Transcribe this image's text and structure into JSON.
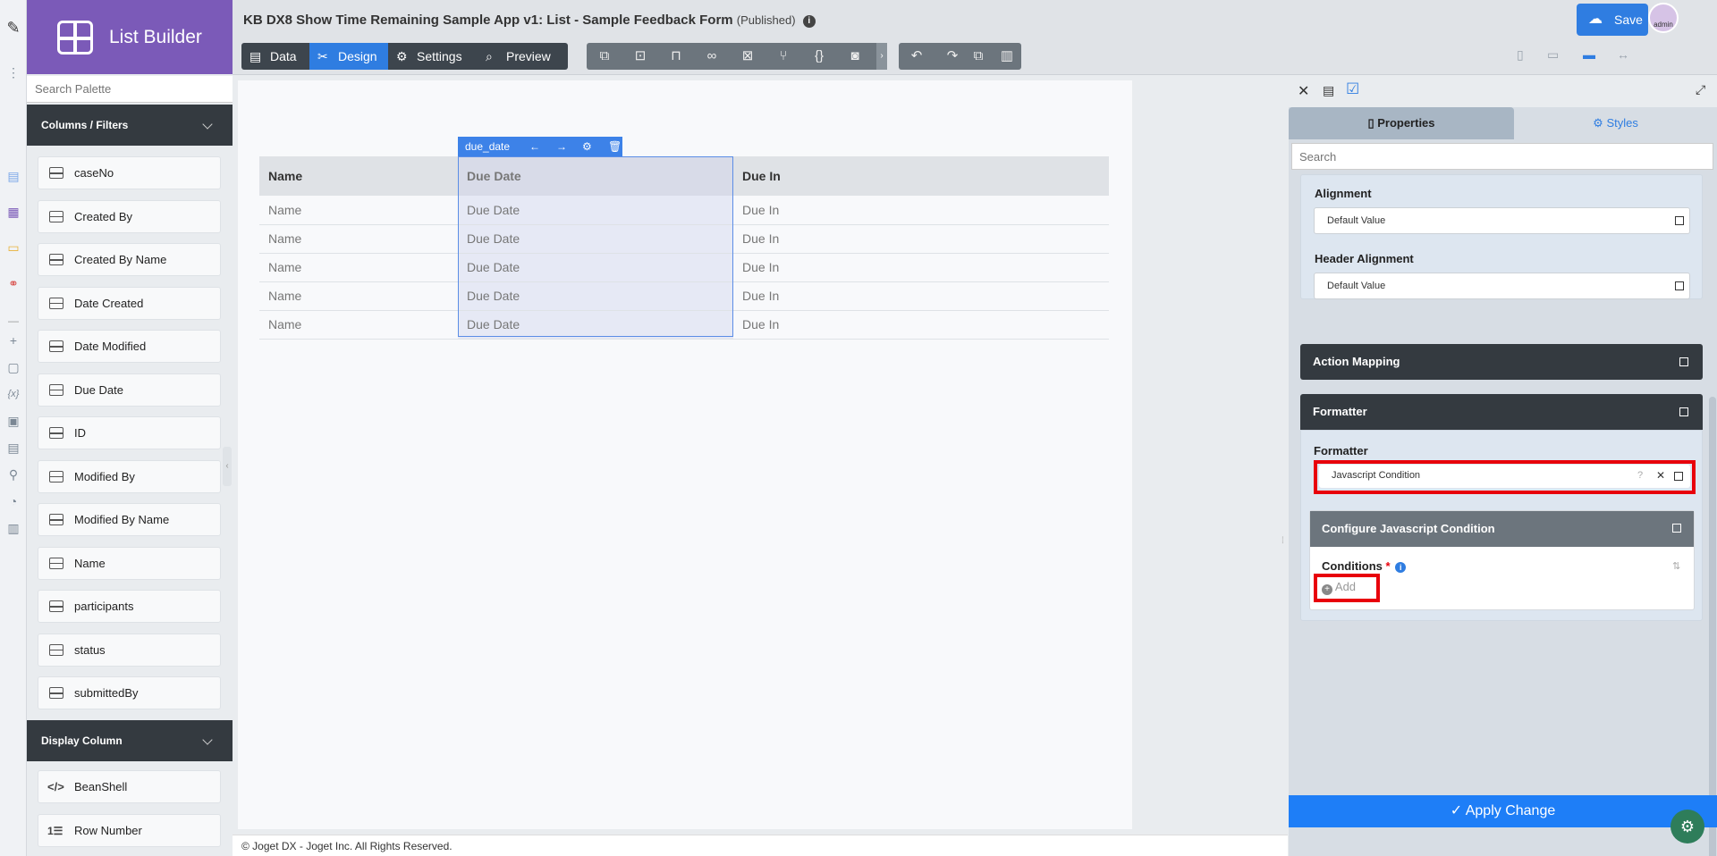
{
  "app": {
    "builder_name": "List Builder",
    "page_title": "KB DX8 Show Time Remaining Sample App v1: List - Sample Feedback Form",
    "status": "(Published)",
    "save_label": "Save",
    "avatar_text": "admin",
    "footer": "© Joget DX - Joget Inc. All Rights Reserved."
  },
  "palette": {
    "search_placeholder": "Search Palette",
    "columns_section": "Columns / Filters",
    "columns": [
      "caseNo",
      "Created By",
      "Created By Name",
      "Date Created",
      "Date Modified",
      "Due Date",
      "ID",
      "Modified By",
      "Modified By Name",
      "Name",
      "participants",
      "status",
      "submittedBy"
    ],
    "display_section": "Display Column",
    "display_items": [
      "BeanShell",
      "Row Number"
    ]
  },
  "toolbar": {
    "tabs": [
      "Data",
      "Design",
      "Settings",
      "Preview"
    ],
    "active_tab": "Design"
  },
  "canvas": {
    "column_tool_label": "due_date",
    "headers": [
      "Name",
      "Due Date",
      "Due In"
    ],
    "rows": [
      [
        "Name",
        "Due Date",
        "Due In"
      ],
      [
        "Name",
        "Due Date",
        "Due In"
      ],
      [
        "Name",
        "Due Date",
        "Due In"
      ],
      [
        "Name",
        "Due Date",
        "Due In"
      ],
      [
        "Name",
        "Due Date",
        "Due In"
      ]
    ]
  },
  "properties": {
    "tab_properties": "Properties",
    "tab_styles": "Styles",
    "search_placeholder": "Search",
    "alignment_label": "Alignment",
    "alignment_value": "Default Value",
    "header_alignment_label": "Header Alignment",
    "header_alignment_value": "Default Value",
    "action_mapping": "Action Mapping",
    "formatter_section": "Formatter",
    "formatter_label": "Formatter",
    "formatter_value": "Javascript Condition",
    "configure_title": "Configure Javascript Condition",
    "conditions_label": "Conditions",
    "required_mark": "*",
    "add_label": "Add",
    "apply_label": "Apply Change"
  },
  "colors": {
    "brand": "#7b5ab8",
    "accent": "#2f7de1",
    "highlight": "#e8000b",
    "dark": "#343a40"
  }
}
